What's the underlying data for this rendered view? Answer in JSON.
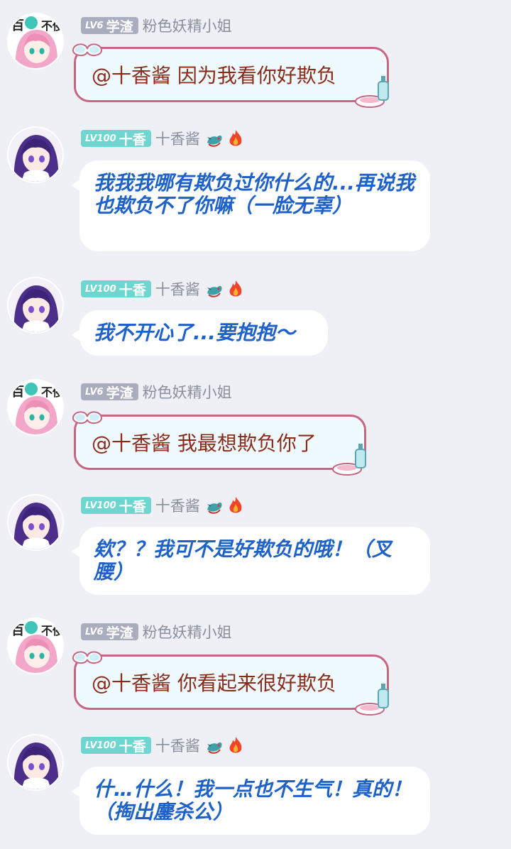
{
  "messages": [
    {
      "user": "粉色妖精小姐",
      "level": "LV6",
      "title": "学渣",
      "text": "@十香酱 因为我看你好欺负"
    },
    {
      "user": "十香酱",
      "level": "LV100",
      "title": "十香",
      "text": "我我我哪有欺负过你什么的...再说我也欺负不了你嘛（一脸无辜）"
    },
    {
      "user": "十香酱",
      "level": "LV100",
      "title": "十香",
      "text": "我不开心了...要抱抱～"
    },
    {
      "user": "粉色妖精小姐",
      "level": "LV6",
      "title": "学渣",
      "text": "@十香酱 我最想欺负你了"
    },
    {
      "user": "十香酱",
      "level": "LV100",
      "title": "十香",
      "text": "欸？？我可不是好欺负的哦！（叉腰）"
    },
    {
      "user": "粉色妖精小姐",
      "level": "LV6",
      "title": "学渣",
      "text": "@十香酱 你看起来很好欺负"
    },
    {
      "user": "十香酱",
      "level": "LV100",
      "title": "十香",
      "text": "什…什么！我一点也不生气！真的！（掏出鏖杀公）"
    }
  ],
  "colors": {
    "background": "#eef0f5",
    "blue_text": "#1d61c9",
    "brown_text": "#8a2c1c",
    "pink_border": "#c56683",
    "badge_gray": "#a9adbe",
    "badge_teal": "#6fd6cf"
  },
  "icons": {
    "dragon": "dragon-icon",
    "fire": "fire-icon",
    "goggles": "goggles-icon",
    "bottle": "bottle-icon"
  }
}
